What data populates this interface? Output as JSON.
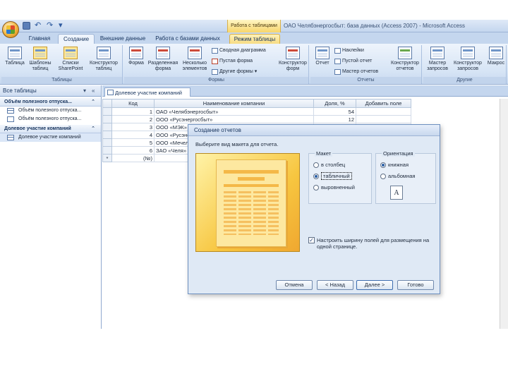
{
  "window": {
    "title": "ОАО Челябэнергосбыт: база данных (Access 2007) - Microsoft Access",
    "context_tab_group": "Работа с таблицами"
  },
  "ribbon_tabs": [
    "Главная",
    "Создание",
    "Внешние данные",
    "Работа с базами данных",
    "Режим таблицы"
  ],
  "ribbon": {
    "tables": {
      "label": "Таблицы",
      "buttons": [
        "Таблица",
        "Шаблоны таблиц",
        "Списки SharePoint",
        "Конструктор таблиц"
      ]
    },
    "forms": {
      "label": "Формы",
      "buttons": [
        "Форма",
        "Разделенная форма",
        "Несколько элементов"
      ],
      "small": [
        "Сводная диаграмма",
        "Пустая форма",
        "Другие формы"
      ],
      "designer": "Конструктор форм"
    },
    "reports": {
      "label": "Отчеты",
      "report": "Отчет",
      "small": [
        "Наклейки",
        "Пустой отчет",
        "Мастер отчетов"
      ],
      "designer": "Конструктор отчетов"
    },
    "other": {
      "label": "Другие",
      "buttons": [
        "Мастер запросов",
        "Конструктор запросов",
        "Макрос"
      ]
    }
  },
  "nav": {
    "header": "Все таблицы",
    "groups": [
      {
        "title": "Объём полезного отпуска...",
        "items": [
          "Объём полезного отпуска...",
          "Объём полезного отпуска..."
        ]
      },
      {
        "title": "Долевое участие компаний",
        "items": [
          "Долевое участие компаний"
        ]
      }
    ]
  },
  "document": {
    "tab": "Долевое участие компаний",
    "columns": [
      "Код",
      "Наименование компании",
      "Доля, %",
      "Добавить поле"
    ],
    "rows": [
      {
        "id": "1",
        "name": "ОАО «Челябэнергосбыт»",
        "share": "54"
      },
      {
        "id": "2",
        "name": "ООО «Русэнергосбыт»",
        "share": "12"
      },
      {
        "id": "3",
        "name": "ООО «МЭК»",
        "share": ""
      },
      {
        "id": "4",
        "name": "ООО «Русэнерго»",
        "share": ""
      },
      {
        "id": "5",
        "name": "ООО «Мечел»",
        "share": ""
      },
      {
        "id": "6",
        "name": "ЗАО «Челя»",
        "share": ""
      }
    ],
    "new_row_marker": "*",
    "new_row_id": "(№)"
  },
  "dialog": {
    "title": "Создание отчетов",
    "prompt": "Выберите вид макета для отчета.",
    "layout": {
      "label": "Макет",
      "options": [
        "в столбец",
        "табличный",
        "выровненный"
      ],
      "selected": "табличный"
    },
    "orientation": {
      "label": "Ориентация",
      "options": [
        "книжная",
        "альбомная"
      ],
      "selected": "книжная",
      "icon_letter": "A"
    },
    "fit_checkbox": {
      "label": "Настроить ширину полей для размещения на одной странице.",
      "checked": true
    },
    "buttons": {
      "cancel": "Отмена",
      "back": "< Назад",
      "next": "Далее >",
      "finish": "Готово"
    }
  }
}
